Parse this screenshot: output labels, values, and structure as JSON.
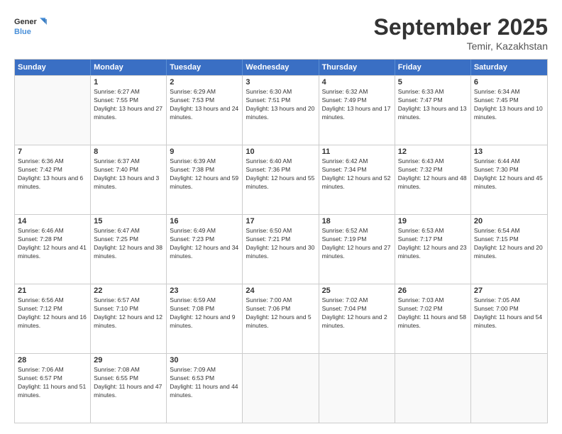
{
  "logo": {
    "general": "General",
    "blue": "Blue"
  },
  "title": "September 2025",
  "subtitle": "Temir, Kazakhstan",
  "weekdays": [
    "Sunday",
    "Monday",
    "Tuesday",
    "Wednesday",
    "Thursday",
    "Friday",
    "Saturday"
  ],
  "weeks": [
    [
      {
        "day": "",
        "empty": true
      },
      {
        "day": "1",
        "sunrise": "6:27 AM",
        "sunset": "7:55 PM",
        "daylight": "13 hours and 27 minutes."
      },
      {
        "day": "2",
        "sunrise": "6:29 AM",
        "sunset": "7:53 PM",
        "daylight": "13 hours and 24 minutes."
      },
      {
        "day": "3",
        "sunrise": "6:30 AM",
        "sunset": "7:51 PM",
        "daylight": "13 hours and 20 minutes."
      },
      {
        "day": "4",
        "sunrise": "6:32 AM",
        "sunset": "7:49 PM",
        "daylight": "13 hours and 17 minutes."
      },
      {
        "day": "5",
        "sunrise": "6:33 AM",
        "sunset": "7:47 PM",
        "daylight": "13 hours and 13 minutes."
      },
      {
        "day": "6",
        "sunrise": "6:34 AM",
        "sunset": "7:45 PM",
        "daylight": "13 hours and 10 minutes."
      }
    ],
    [
      {
        "day": "7",
        "sunrise": "6:36 AM",
        "sunset": "7:42 PM",
        "daylight": "13 hours and 6 minutes."
      },
      {
        "day": "8",
        "sunrise": "6:37 AM",
        "sunset": "7:40 PM",
        "daylight": "13 hours and 3 minutes."
      },
      {
        "day": "9",
        "sunrise": "6:39 AM",
        "sunset": "7:38 PM",
        "daylight": "12 hours and 59 minutes."
      },
      {
        "day": "10",
        "sunrise": "6:40 AM",
        "sunset": "7:36 PM",
        "daylight": "12 hours and 55 minutes."
      },
      {
        "day": "11",
        "sunrise": "6:42 AM",
        "sunset": "7:34 PM",
        "daylight": "12 hours and 52 minutes."
      },
      {
        "day": "12",
        "sunrise": "6:43 AM",
        "sunset": "7:32 PM",
        "daylight": "12 hours and 48 minutes."
      },
      {
        "day": "13",
        "sunrise": "6:44 AM",
        "sunset": "7:30 PM",
        "daylight": "12 hours and 45 minutes."
      }
    ],
    [
      {
        "day": "14",
        "sunrise": "6:46 AM",
        "sunset": "7:28 PM",
        "daylight": "12 hours and 41 minutes."
      },
      {
        "day": "15",
        "sunrise": "6:47 AM",
        "sunset": "7:25 PM",
        "daylight": "12 hours and 38 minutes."
      },
      {
        "day": "16",
        "sunrise": "6:49 AM",
        "sunset": "7:23 PM",
        "daylight": "12 hours and 34 minutes."
      },
      {
        "day": "17",
        "sunrise": "6:50 AM",
        "sunset": "7:21 PM",
        "daylight": "12 hours and 30 minutes."
      },
      {
        "day": "18",
        "sunrise": "6:52 AM",
        "sunset": "7:19 PM",
        "daylight": "12 hours and 27 minutes."
      },
      {
        "day": "19",
        "sunrise": "6:53 AM",
        "sunset": "7:17 PM",
        "daylight": "12 hours and 23 minutes."
      },
      {
        "day": "20",
        "sunrise": "6:54 AM",
        "sunset": "7:15 PM",
        "daylight": "12 hours and 20 minutes."
      }
    ],
    [
      {
        "day": "21",
        "sunrise": "6:56 AM",
        "sunset": "7:12 PM",
        "daylight": "12 hours and 16 minutes."
      },
      {
        "day": "22",
        "sunrise": "6:57 AM",
        "sunset": "7:10 PM",
        "daylight": "12 hours and 12 minutes."
      },
      {
        "day": "23",
        "sunrise": "6:59 AM",
        "sunset": "7:08 PM",
        "daylight": "12 hours and 9 minutes."
      },
      {
        "day": "24",
        "sunrise": "7:00 AM",
        "sunset": "7:06 PM",
        "daylight": "12 hours and 5 minutes."
      },
      {
        "day": "25",
        "sunrise": "7:02 AM",
        "sunset": "7:04 PM",
        "daylight": "12 hours and 2 minutes."
      },
      {
        "day": "26",
        "sunrise": "7:03 AM",
        "sunset": "7:02 PM",
        "daylight": "11 hours and 58 minutes."
      },
      {
        "day": "27",
        "sunrise": "7:05 AM",
        "sunset": "7:00 PM",
        "daylight": "11 hours and 54 minutes."
      }
    ],
    [
      {
        "day": "28",
        "sunrise": "7:06 AM",
        "sunset": "6:57 PM",
        "daylight": "11 hours and 51 minutes."
      },
      {
        "day": "29",
        "sunrise": "7:08 AM",
        "sunset": "6:55 PM",
        "daylight": "11 hours and 47 minutes."
      },
      {
        "day": "30",
        "sunrise": "7:09 AM",
        "sunset": "6:53 PM",
        "daylight": "11 hours and 44 minutes."
      },
      {
        "day": "",
        "empty": true
      },
      {
        "day": "",
        "empty": true
      },
      {
        "day": "",
        "empty": true
      },
      {
        "day": "",
        "empty": true
      }
    ]
  ]
}
